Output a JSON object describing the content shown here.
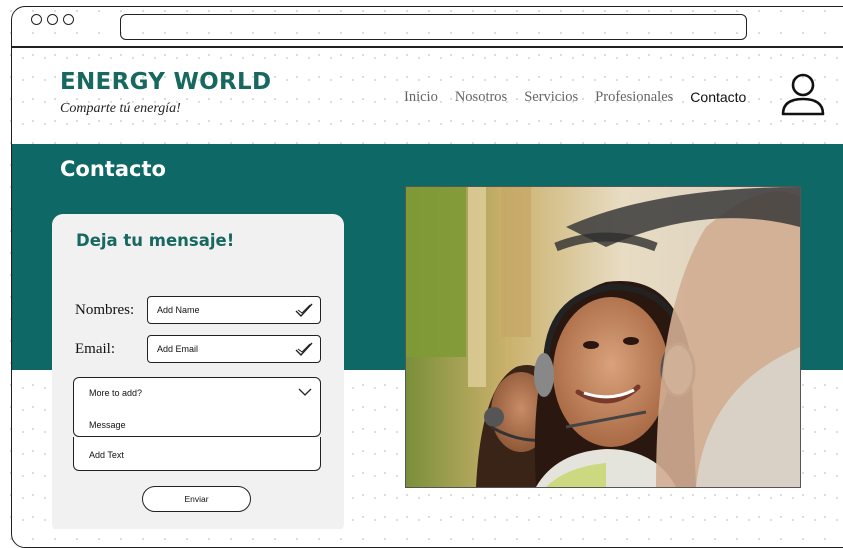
{
  "brand": {
    "title": "ENERGY WORLD",
    "tagline": "Comparte tú energía!"
  },
  "nav": {
    "items": [
      "Inicio",
      "Nosotros",
      "Servicios",
      "Profesionales",
      "Contacto"
    ],
    "active": "Contacto"
  },
  "section": {
    "title": "Contacto"
  },
  "form": {
    "title": "Deja tu mensaje!",
    "name_label": "Nombres:",
    "name_value": "Add Name",
    "email_label": "Email:",
    "email_value": "Add Email",
    "select_value": "More to add?",
    "select_option": "Message",
    "text_value": "Add Text",
    "submit_label": "Enviar"
  },
  "colors": {
    "brand": "#17685f",
    "band": "#0d6866",
    "form_bg": "#f1f1f1"
  },
  "icons": [
    "user-icon",
    "check-icon",
    "chevron-down-icon"
  ]
}
